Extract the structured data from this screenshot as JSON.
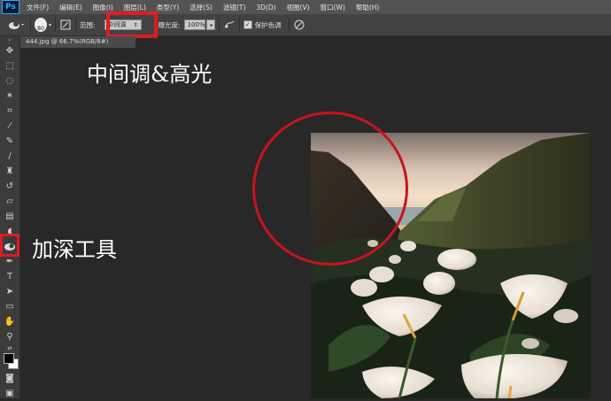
{
  "app": {
    "logo": "Ps"
  },
  "menu": [
    "文件(F)",
    "编辑(E)",
    "图像(I)",
    "图层(L)",
    "类型(Y)",
    "选择(S)",
    "滤镜(T)",
    "3D(D)",
    "视图(V)",
    "窗口(W)",
    "帮助(H)"
  ],
  "options": {
    "brush_size": "80",
    "range_label": "范围:",
    "range_value": "中间调",
    "exposure_label": "曝光度:",
    "exposure_value": "100%",
    "protect_tones_label": "保护色调",
    "protect_tones_checked": true
  },
  "document": {
    "tab_title": "444.jpg @ 66.7%(RGB/8#)"
  },
  "annotations": {
    "midtones": "中间调&高光",
    "burn_tool": "加深工具"
  },
  "colors": {
    "highlight_red": "#e01b24",
    "circle_red": "#c8141a"
  }
}
